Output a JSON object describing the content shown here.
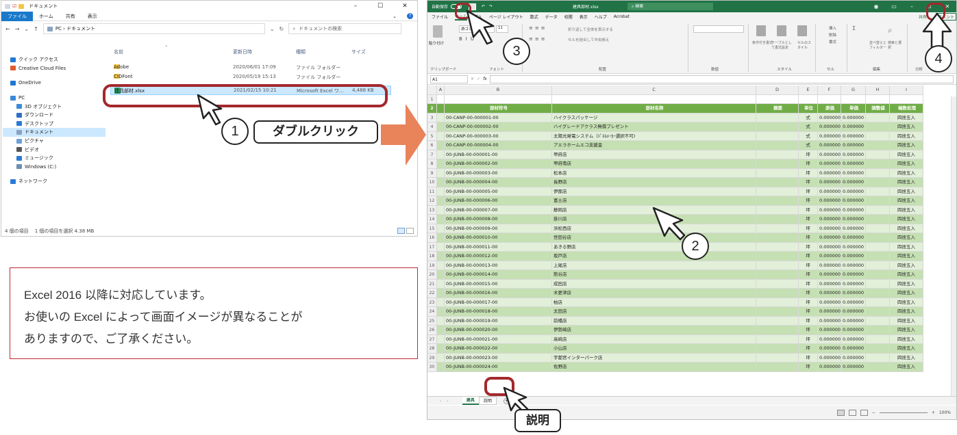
{
  "explorer": {
    "title": "ドキュメント",
    "ribbon_tabs": [
      "ファイル",
      "ホーム",
      "共有",
      "表示"
    ],
    "address": "PC › ドキュメント",
    "search_placeholder": "ドキュメントの検索",
    "nav": [
      {
        "label": "クイック アクセス",
        "icon": "star-icon",
        "color": "#1e78d4",
        "sub": false
      },
      {
        "label": "Creative Cloud Files",
        "icon": "cloud-icon",
        "color": "#e05a2a",
        "sub": false
      },
      {
        "label": "OneDrive",
        "icon": "cloud-icon",
        "color": "#1e78d4",
        "sub": false
      },
      {
        "label": "PC",
        "icon": "pc-icon",
        "color": "#3a8ad8",
        "sub": false
      },
      {
        "label": "3D オブジェクト",
        "icon": "cube-icon",
        "color": "#3a8ad8",
        "sub": true
      },
      {
        "label": "ダウンロード",
        "icon": "download-icon",
        "color": "#2c6fc4",
        "sub": true
      },
      {
        "label": "デスクトップ",
        "icon": "desktop-icon",
        "color": "#2b7bd5",
        "sub": true
      },
      {
        "label": "ドキュメント",
        "icon": "document-icon",
        "color": "#8aa3c1",
        "sub": true,
        "selected": true
      },
      {
        "label": "ピクチャ",
        "icon": "picture-icon",
        "color": "#6aa0d8",
        "sub": true
      },
      {
        "label": "ビデオ",
        "icon": "video-icon",
        "color": "#555555",
        "sub": true
      },
      {
        "label": "ミュージック",
        "icon": "music-icon",
        "color": "#2b7bd5",
        "sub": true
      },
      {
        "label": "Windows (C:)",
        "icon": "drive-icon",
        "color": "#6b8fb5",
        "sub": true
      },
      {
        "label": "ネットワーク",
        "icon": "network-icon",
        "color": "#2b7bd5",
        "sub": false
      }
    ],
    "columns": {
      "name": "名前",
      "date": "更新日時",
      "type": "種類",
      "size": "サイズ"
    },
    "files": [
      {
        "name": "Adobe",
        "date": "2020/06/01 17:09",
        "type": "ファイル フォルダー",
        "size": "",
        "kind": "folder"
      },
      {
        "name": "CIDFont",
        "date": "2020/05/19 15:13",
        "type": "ファイル フォルダー",
        "size": "",
        "kind": "folder"
      },
      {
        "name": "建具部材.xlsx",
        "date": "2021/02/15 10:21",
        "type": "Microsoft Excel ワ...",
        "size": "4,488 KB",
        "kind": "excel",
        "selected": true
      }
    ],
    "status": {
      "count": "4 個の項目",
      "selected": "1 個の項目を選択 4.38 MB"
    }
  },
  "note": {
    "line1": "Excel 2016 以降に対応しています。",
    "line2": "お使いの Excel によって画面イメージが異なることが",
    "line3": "ありますので、ご了承ください。"
  },
  "excel": {
    "autosave": "自動保存",
    "filename": "建具部材.xlsx",
    "search": "検索",
    "tabs": [
      "ファイル",
      "ホーム",
      "挿入",
      "ページ レイアウト",
      "数式",
      "データ",
      "校閲",
      "表示",
      "ヘルプ",
      "Acrobat"
    ],
    "share": "共有",
    "comment": "コメント",
    "ribbon": {
      "paste": "貼り付け",
      "font_name": "游ゴシック",
      "font_size": "11",
      "wrap": "折り返して全体を表示する",
      "merge": "セルを結合して中央揃え",
      "cond": "条件付き書式",
      "table": "テーブルとして書式設定",
      "cellstyle": "セルのスタイル",
      "insert": "挿入",
      "delete": "削除",
      "format": "書式",
      "sort": "並べ替えとフィルター",
      "find": "検索と選択",
      "groups": [
        "クリップボード",
        "フォント",
        "配置",
        "数値",
        "スタイル",
        "セル",
        "編集",
        "分析"
      ]
    },
    "namebox": "A1",
    "col_letters": [
      "",
      "A",
      "B",
      "C",
      "D",
      "E",
      "F",
      "G",
      "H",
      "I"
    ],
    "headers": [
      "",
      "",
      "部材符号",
      "部材名称",
      "摘要",
      "単位",
      "原価",
      "単価",
      "調整値",
      "端数処理"
    ],
    "rows": [
      [
        "3",
        "00-CANP-00-000001-00",
        "ハイクラスパッケージ",
        "式"
      ],
      [
        "4",
        "00-CANP-00-000002-00",
        "ハイグレードアクラス無償プレゼント",
        "式"
      ],
      [
        "5",
        "00-CANP-00-000003-00",
        "太陽光発電システム（ﾊﾟﾈﾙﾒｰｶｰ選択不可)",
        "式"
      ],
      [
        "6",
        "00-CANP-00-000004-00",
        "アエラホームエコ支援金",
        "式"
      ],
      [
        "7",
        "00-JUNB-00-000001-00",
        "甲府店",
        "坪"
      ],
      [
        "8",
        "00-JUNB-00-000002-00",
        "甲府南店",
        "坪"
      ],
      [
        "9",
        "00-JUNB-00-000003-00",
        "松本店",
        "坪"
      ],
      [
        "10",
        "00-JUNB-00-000004-00",
        "長野店",
        "坪"
      ],
      [
        "11",
        "00-JUNB-00-000005-00",
        "伊那店",
        "坪"
      ],
      [
        "12",
        "00-JUNB-00-000006-00",
        "富士店",
        "坪"
      ],
      [
        "13",
        "00-JUNB-00-000007-00",
        "静岡店",
        "坪"
      ],
      [
        "14",
        "00-JUNB-00-000008-00",
        "掛川店",
        "坪"
      ],
      [
        "15",
        "00-JUNB-00-000009-00",
        "浜松西店",
        "坪"
      ],
      [
        "16",
        "00-JUNB-00-000010-00",
        "世田谷店",
        "坪"
      ],
      [
        "17",
        "00-JUNB-00-000011-00",
        "あきる野店",
        "坪"
      ],
      [
        "18",
        "00-JUNB-00-000012-00",
        "坂戸店",
        "坪"
      ],
      [
        "19",
        "00-JUNB-00-000013-00",
        "上尾店",
        "坪"
      ],
      [
        "20",
        "00-JUNB-00-000014-00",
        "熊谷店",
        "坪"
      ],
      [
        "21",
        "00-JUNB-00-000015-00",
        "成田店",
        "坪"
      ],
      [
        "22",
        "00-JUNB-00-000016-00",
        "木更津店",
        "坪"
      ],
      [
        "23",
        "00-JUNB-00-000017-00",
        "柏店",
        "坪"
      ],
      [
        "24",
        "00-JUNB-00-000018-00",
        "太田店",
        "坪"
      ],
      [
        "25",
        "00-JUNB-00-000019-00",
        "前橋店",
        "坪"
      ],
      [
        "26",
        "00-JUNB-00-000020-00",
        "伊勢崎店",
        "坪"
      ],
      [
        "27",
        "00-JUNB-00-000021-00",
        "高崎店",
        "坪"
      ],
      [
        "28",
        "00-JUNB-00-000022-00",
        "小山店",
        "坪"
      ],
      [
        "29",
        "00-JUNB-00-000023-00",
        "宇都宮インターパーク店",
        "坪"
      ],
      [
        "30",
        "00-JUNB-00-000024-00",
        "佐野店",
        "坪"
      ]
    ],
    "zero": "0.000000",
    "rounding": "四捨五入",
    "sheets": [
      "建具",
      "説明"
    ],
    "zoom": "100%"
  },
  "callouts": {
    "c1": "1",
    "c2": "2",
    "c3": "3",
    "c4": "4",
    "double_click": "ダブルクリック",
    "setsumei": "説明"
  }
}
